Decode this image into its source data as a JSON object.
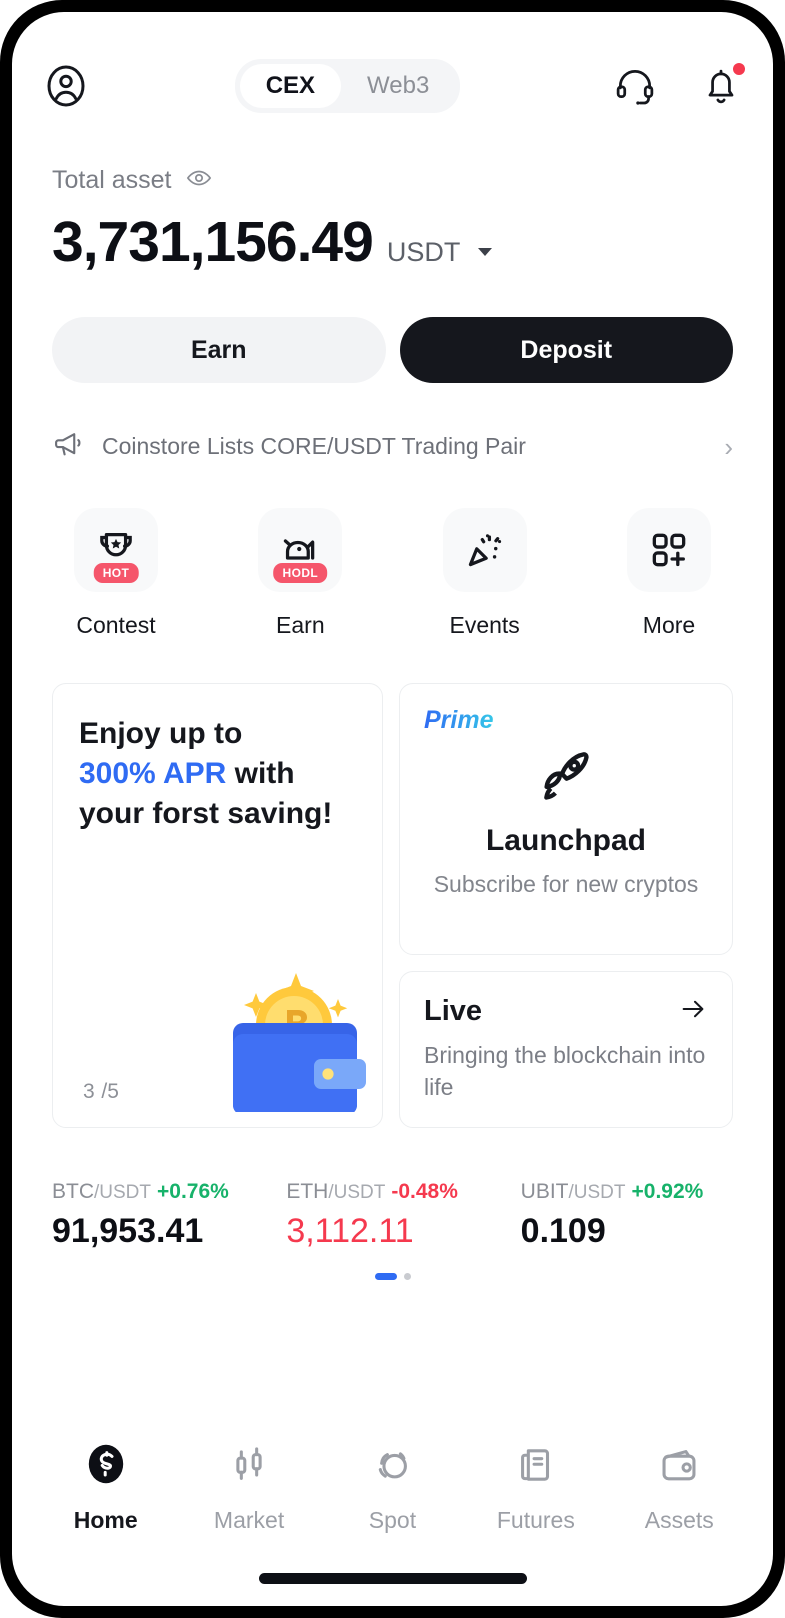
{
  "header": {
    "profile_icon": "user-circle-icon",
    "tabs": [
      {
        "label": "CEX",
        "active": true
      },
      {
        "label": "Web3",
        "active": false
      }
    ],
    "support_icon": "headset-icon",
    "notification_icon": "bell-icon",
    "notification_badge": true
  },
  "asset": {
    "label": "Total asset",
    "eye_icon": "eye-icon",
    "value": "3,731,156.49",
    "currency": "USDT",
    "currency_caret": "chevron-down-icon"
  },
  "actions": {
    "earn_label": "Earn",
    "deposit_label": "Deposit"
  },
  "announcement": {
    "icon": "megaphone-icon",
    "text": "Coinstore Lists CORE/USDT Trading Pair",
    "chevron": "chevron-right-icon"
  },
  "quick_actions": [
    {
      "label": "Contest",
      "icon": "trophy-icon",
      "badge": "HOT"
    },
    {
      "label": "Earn",
      "icon": "piggy-coin-icon",
      "badge": "HODL"
    },
    {
      "label": "Events",
      "icon": "party-popper-icon",
      "badge": ""
    },
    {
      "label": "More",
      "icon": "grid-plus-icon",
      "badge": ""
    }
  ],
  "promo_card": {
    "line1": "Enjoy up to",
    "highlight": "300% APR",
    "line2_rest": " with",
    "line3": "your forst saving!",
    "counter_current": "3",
    "counter_total": "/5",
    "art": "wallet-bitcoin-icon"
  },
  "prime_card": {
    "tag": "Prime",
    "icon": "rocket-icon",
    "title": "Launchpad",
    "subtitle": "Subscribe for new cryptos"
  },
  "live_card": {
    "title": "Live",
    "arrow_icon": "arrow-right-icon",
    "subtitle": "Bringing the blockchain into life"
  },
  "tickers": [
    {
      "base": "BTC",
      "quote": "/USDT",
      "change": "+0.76%",
      "direction": "up",
      "price": "91,953.41"
    },
    {
      "base": "ETH",
      "quote": "/USDT",
      "change": "-0.48%",
      "direction": "down",
      "price": "3,112.11"
    },
    {
      "base": "UBIT",
      "quote": "/USDT",
      "change": "+0.92%",
      "direction": "up",
      "price": "0.109"
    }
  ],
  "carousel": {
    "pages": 2,
    "active_index": 0
  },
  "bottom_nav": [
    {
      "label": "Home",
      "icon": "coinstore-logo-icon",
      "active": true
    },
    {
      "label": "Market",
      "icon": "candlestick-icon",
      "active": false
    },
    {
      "label": "Spot",
      "icon": "swap-circles-icon",
      "active": false
    },
    {
      "label": "Futures",
      "icon": "document-chart-icon",
      "active": false
    },
    {
      "label": "Assets",
      "icon": "wallet-icon",
      "active": false
    }
  ],
  "colors": {
    "accent_blue": "#2f6bf3",
    "up_green": "#17b26a",
    "down_red": "#f5394e",
    "badge_red": "#f5566b",
    "dark": "#15171d"
  }
}
